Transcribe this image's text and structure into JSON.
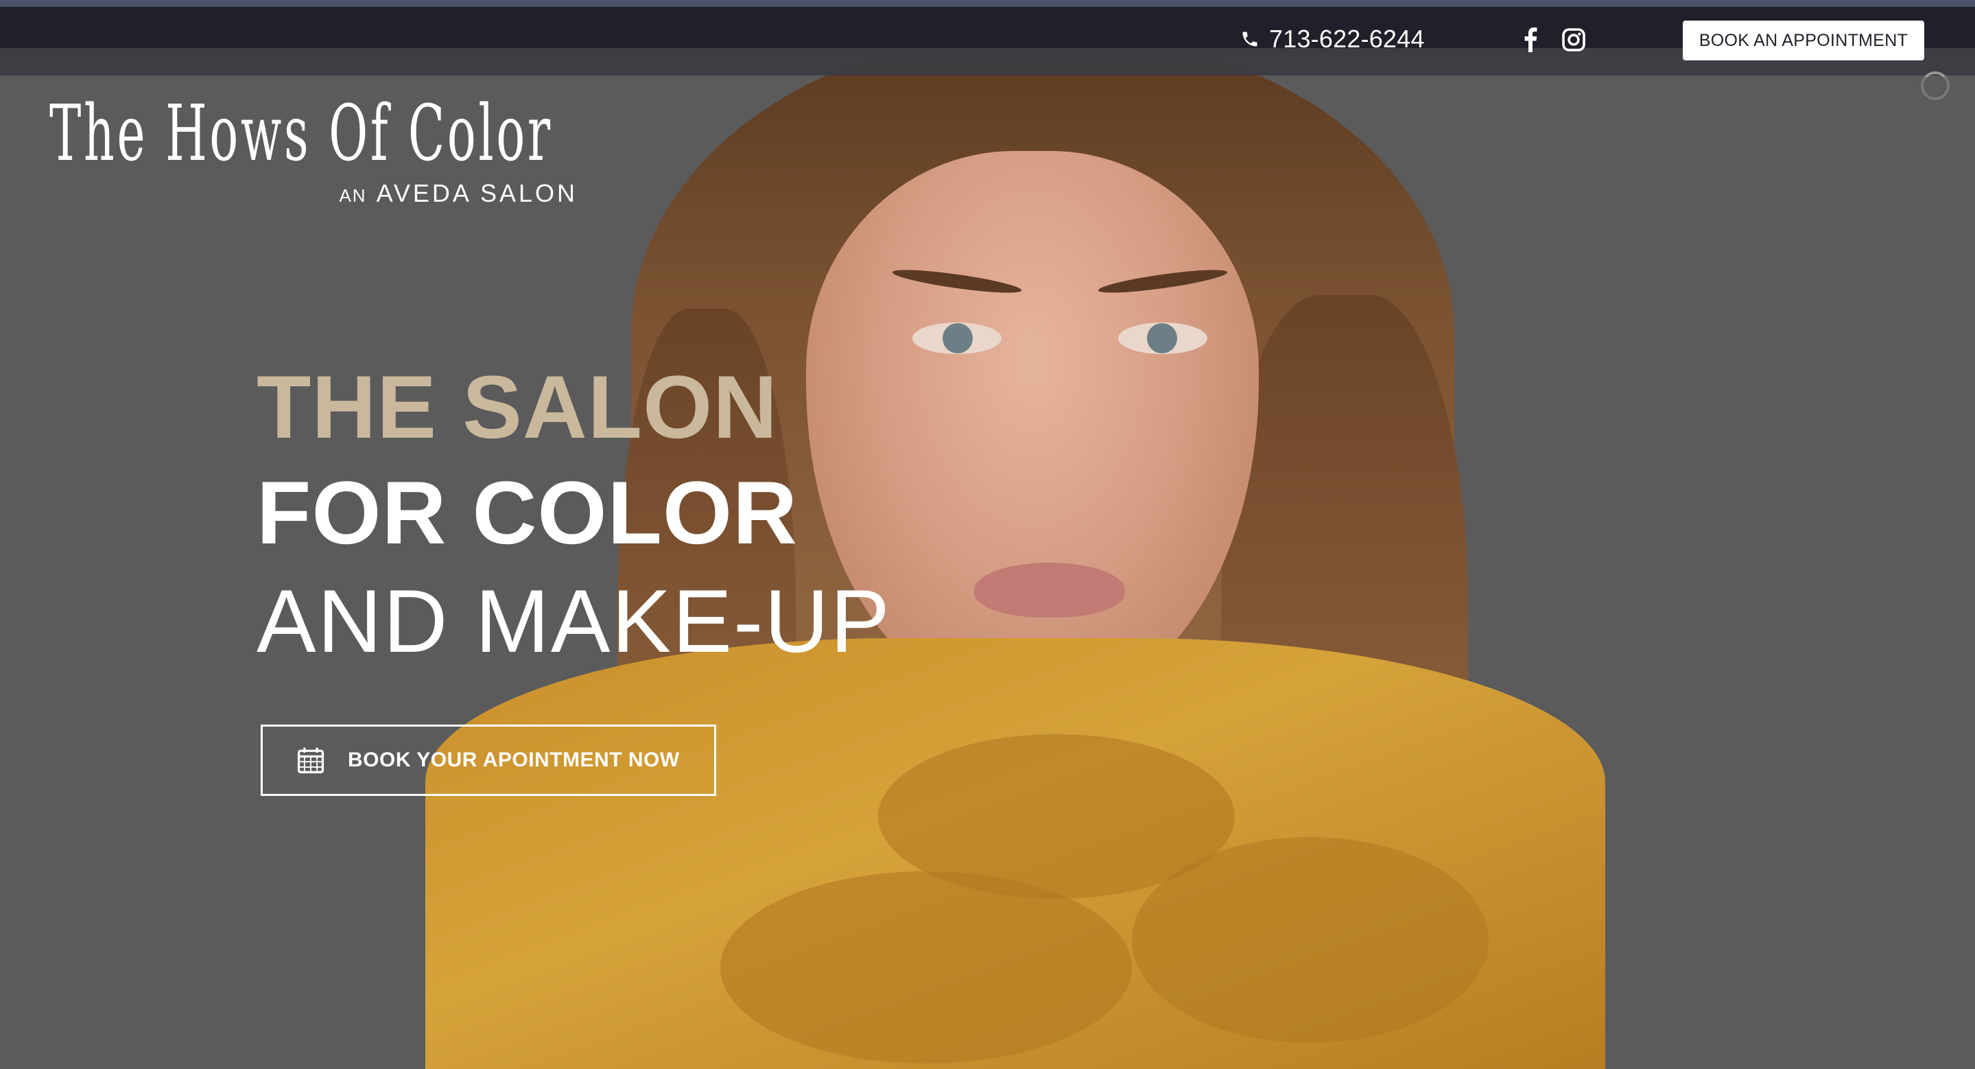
{
  "header": {
    "phone": "713-622-6244",
    "book_button": "BOOK AN APPOINTMENT",
    "social": [
      "facebook-icon",
      "instagram-icon"
    ]
  },
  "logo": {
    "main": "The Hows Of Color",
    "prefix": "AN",
    "sub": "AVEDA SALON"
  },
  "hero": {
    "line1": "THE SALON",
    "line2": "FOR COLOR",
    "line3": "AND MAKE-UP",
    "cta": "BOOK YOUR APOINTMENT NOW"
  },
  "colors": {
    "topbar": "#1f2029",
    "background": "#5b5b5c",
    "accent": "#c9b89c",
    "text": "#ffffff"
  }
}
